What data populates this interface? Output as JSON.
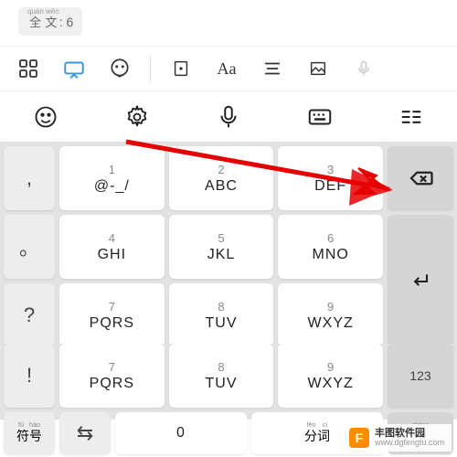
{
  "top_pill": {
    "text": "全文",
    "ruby": "quán wén",
    "suffix": ": 6"
  },
  "toolbar1": {
    "apps_icon": "apps",
    "keyboard_icon": "keyboard",
    "emoji_icon": "emoji",
    "rect_icon": "rect",
    "font_icon": "Aa",
    "align_icon": "align",
    "image_icon": "image",
    "mic_icon": "mic"
  },
  "toolbar2": {
    "smiley": "smiley",
    "gear": "gear",
    "mic": "mic",
    "keyboard": "keyboard",
    "menu": "menu"
  },
  "keys": {
    "side": [
      ",",
      "。",
      "?",
      "!"
    ],
    "main": [
      {
        "num": "1",
        "text": "@-_/"
      },
      {
        "num": "2",
        "text": "ABC"
      },
      {
        "num": "3",
        "text": "DEF"
      },
      {
        "num": "4",
        "text": "GHI"
      },
      {
        "num": "5",
        "text": "JKL"
      },
      {
        "num": "6",
        "text": "MNO"
      },
      {
        "num": "7",
        "text": "PQRS"
      },
      {
        "num": "8",
        "text": "TUV"
      },
      {
        "num": "9",
        "text": "WXYZ"
      }
    ],
    "backspace": "⌫",
    "enter": "↵",
    "num123": "123",
    "bottom": {
      "symbol": {
        "text": "符号",
        "ruby": "fú hào"
      },
      "switch": "⇆",
      "zero": {
        "num": "",
        "text": "0"
      },
      "split": {
        "text": "分词",
        "ruby": "fēn cí"
      },
      "lang": {
        "text": "中",
        "ruby": "zhōng"
      }
    }
  },
  "watermark": {
    "cn": "丰图软件园",
    "url": "www.dgfengtu.com",
    "logo": "F"
  }
}
